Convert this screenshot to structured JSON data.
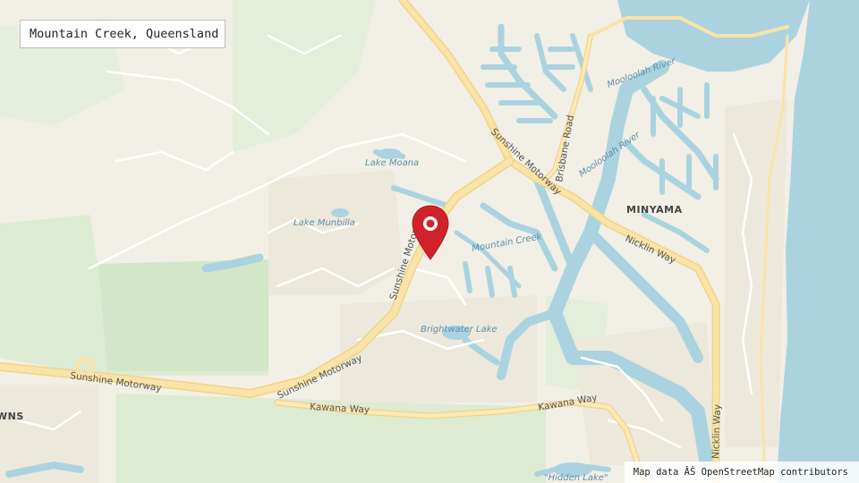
{
  "title": "Mountain Creek, Queensland",
  "attribution": "Map data ÂŠ OpenStreetMap contributors",
  "marker": {
    "icon": "map-pin-icon",
    "color": "#d0222a"
  },
  "colors": {
    "land": "#f2efe6",
    "water": "#aad3df",
    "green": "#dcebd2",
    "major_road": "#f7e0a0",
    "minor_road": "#ffffff",
    "water_label": "#5b8fa8",
    "road_label": "#555555"
  },
  "labels": {
    "suburbs": [
      "MINYAMA",
      "WNS"
    ],
    "water": [
      "Lake Moana",
      "Lake Munbilla",
      "Mountain Creek",
      "Brightwater Lake",
      "Mooloolah River",
      "Mooloolah River",
      "\"Hidden Lake\""
    ],
    "roads": [
      "Sunshine Motorway",
      "Sunshine Motorway",
      "Sunshine Motorway",
      "Sunshine Motorway",
      "Kawana Way",
      "Kawana Way",
      "Brisbane Road",
      "Nicklin Way",
      "Nicklin Way"
    ]
  }
}
